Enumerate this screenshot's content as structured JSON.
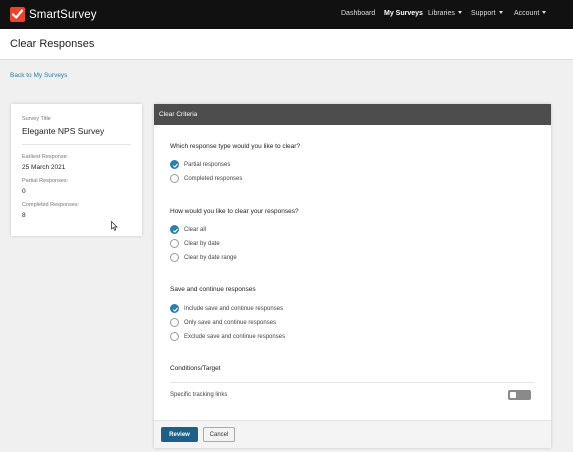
{
  "nav": {
    "brand": "SmartSurvey",
    "items": [
      {
        "label": "Dashboard"
      },
      {
        "label": "My Surveys"
      },
      {
        "label": "Libraries"
      },
      {
        "label": "Support"
      },
      {
        "label": "Account"
      }
    ]
  },
  "page": {
    "title": "Clear Responses",
    "back_link": "Back to My Surveys"
  },
  "summary": {
    "survey_title_label": "Survey Title",
    "survey_title": "Elegante NPS Survey",
    "earliest_label": "Earliest Response:",
    "earliest_value": "25 March 2021",
    "partial_label": "Partial Responses:",
    "partial_value": "0",
    "completed_label": "Completed Responses:",
    "completed_value": "8"
  },
  "criteria": {
    "header": "Clear Criteria",
    "q1": {
      "question": "Which response type would you like to clear?",
      "options": [
        {
          "label": "Partial responses",
          "checked": true
        },
        {
          "label": "Completed responses",
          "checked": false
        }
      ]
    },
    "q2": {
      "question": "How would you like to clear your responses?",
      "options": [
        {
          "label": "Clear all",
          "checked": true
        },
        {
          "label": "Clear by date",
          "checked": false
        },
        {
          "label": "Clear by date range",
          "checked": false
        }
      ]
    },
    "q3": {
      "question": "Save and continue responses",
      "options": [
        {
          "label": "Include save and continue responses",
          "checked": true
        },
        {
          "label": "Only save and continue responses",
          "checked": false
        },
        {
          "label": "Exclude save and continue responses",
          "checked": false
        }
      ]
    },
    "conditions": {
      "heading": "Conditions/Target",
      "toggle_label": "Specific tracking links",
      "toggle_on": false
    },
    "buttons": {
      "review": "Review",
      "cancel": "Cancel"
    }
  },
  "colors": {
    "accent": "#2b7fab",
    "primary_button": "#1d5f85",
    "brand": "#e8452c"
  }
}
